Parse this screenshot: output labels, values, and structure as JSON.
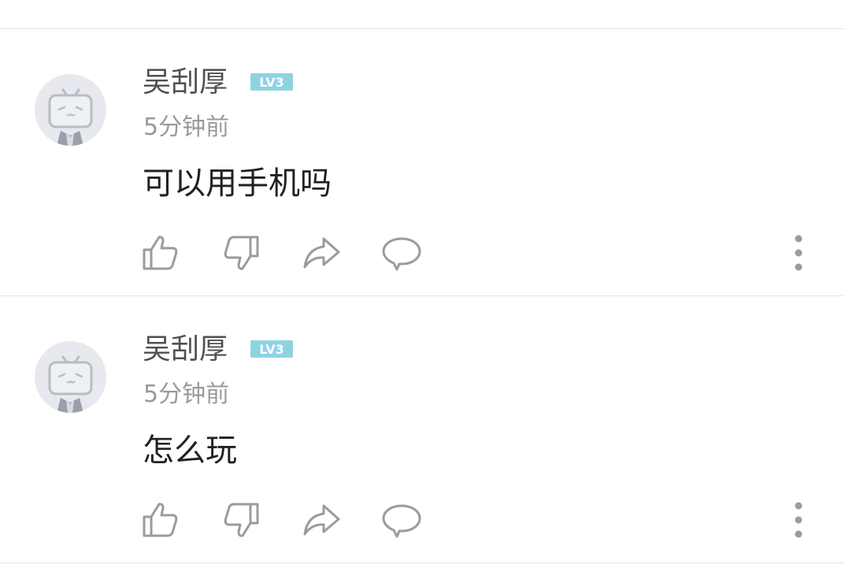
{
  "comments": [
    {
      "username": "吴刮厚",
      "level": "LV3",
      "time": "5分钟前",
      "content": "可以用手机吗"
    },
    {
      "username": "吴刮厚",
      "level": "LV3",
      "time": "5分钟前",
      "content": "怎么玩"
    }
  ],
  "icons": {
    "like": "thumbs-up-icon",
    "dislike": "thumbs-down-icon",
    "share": "share-icon",
    "reply": "comment-bubble-icon",
    "more": "more-vertical-icon"
  },
  "colors": {
    "level_badge": "#8fd3e3",
    "icon_gray": "#9b9b9b",
    "text_primary": "#212121",
    "text_name": "#505050",
    "text_time": "#9a9a9a"
  }
}
